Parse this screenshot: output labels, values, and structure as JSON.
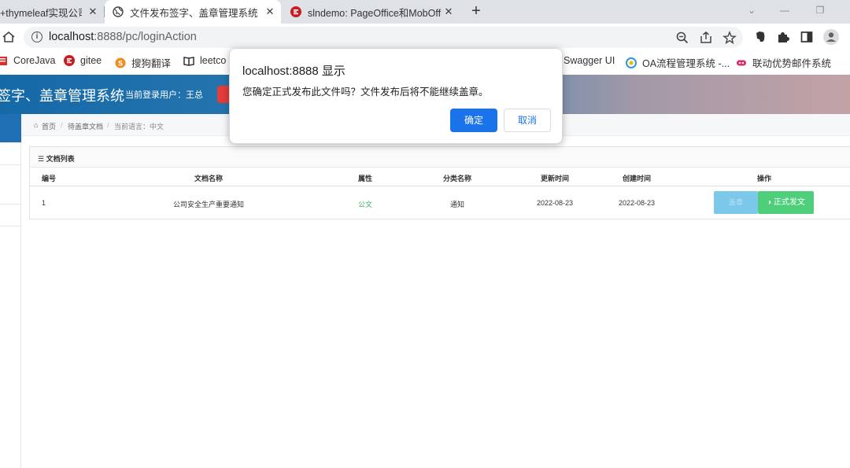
{
  "browser": {
    "tabs": [
      {
        "title": "+thymeleaf实现公司",
        "icon": "none",
        "active": false
      },
      {
        "title": "文件发布签字、盖章管理系统",
        "icon": "globe-icon",
        "active": true
      },
      {
        "title": "slndemo: PageOffice和MobOffi",
        "icon": "gitee-icon",
        "active": false
      }
    ],
    "new_tab_label": "+",
    "url_host": "localhost",
    "url_rest": ":8888/pc/loginAction",
    "bookmarks": [
      {
        "label": "CoreJava",
        "icon": "folder-red-icon"
      },
      {
        "label": "gitee",
        "icon": "gitee-icon"
      },
      {
        "label": "搜狗翻译",
        "icon": "sogou-icon"
      },
      {
        "label": "leetco",
        "icon": "book-icon"
      },
      {
        "label": "Swagger UI",
        "icon": "none"
      },
      {
        "label": "OA流程管理系统 -...",
        "icon": "oa-icon"
      },
      {
        "label": "联动优势邮件系统",
        "icon": "mail-icon"
      }
    ],
    "colors": {
      "tabstrip": "#dee1e6",
      "omnibox": "#f1f3f4",
      "accent": "#1a73e8"
    }
  },
  "app": {
    "title": "签字、盖章管理系统",
    "user_label": "当前登录用户：王总",
    "breadcrumb": {
      "home": "首页",
      "sep": "/",
      "current": "待盖章文档",
      "lang": "当前语言：中文"
    },
    "panel_title": "文档列表",
    "columns": [
      "编号",
      "文档名称",
      "属性",
      "分类名称",
      "更新时间",
      "创建时间",
      "操作"
    ],
    "rows": [
      {
        "id": "1",
        "name": "公司安全生产重要通知",
        "attr": "公文",
        "category": "通知",
        "updated": "2022-08-23",
        "created": "2022-08-23",
        "action_seal": "盖章",
        "action_publish": "◑ 正式发文"
      }
    ],
    "colors": {
      "header_start": "#1569a7",
      "header_end": "#c3a2a6",
      "attr_green": "#3cb371",
      "seal_btn": "#7cc8ea",
      "publish_btn": "#4fcf7c"
    }
  },
  "dialog": {
    "title": "localhost:8888 显示",
    "message": "您确定正式发布此文件吗？文件发布后将不能继续盖章。",
    "ok_label": "确定",
    "cancel_label": "取消"
  }
}
